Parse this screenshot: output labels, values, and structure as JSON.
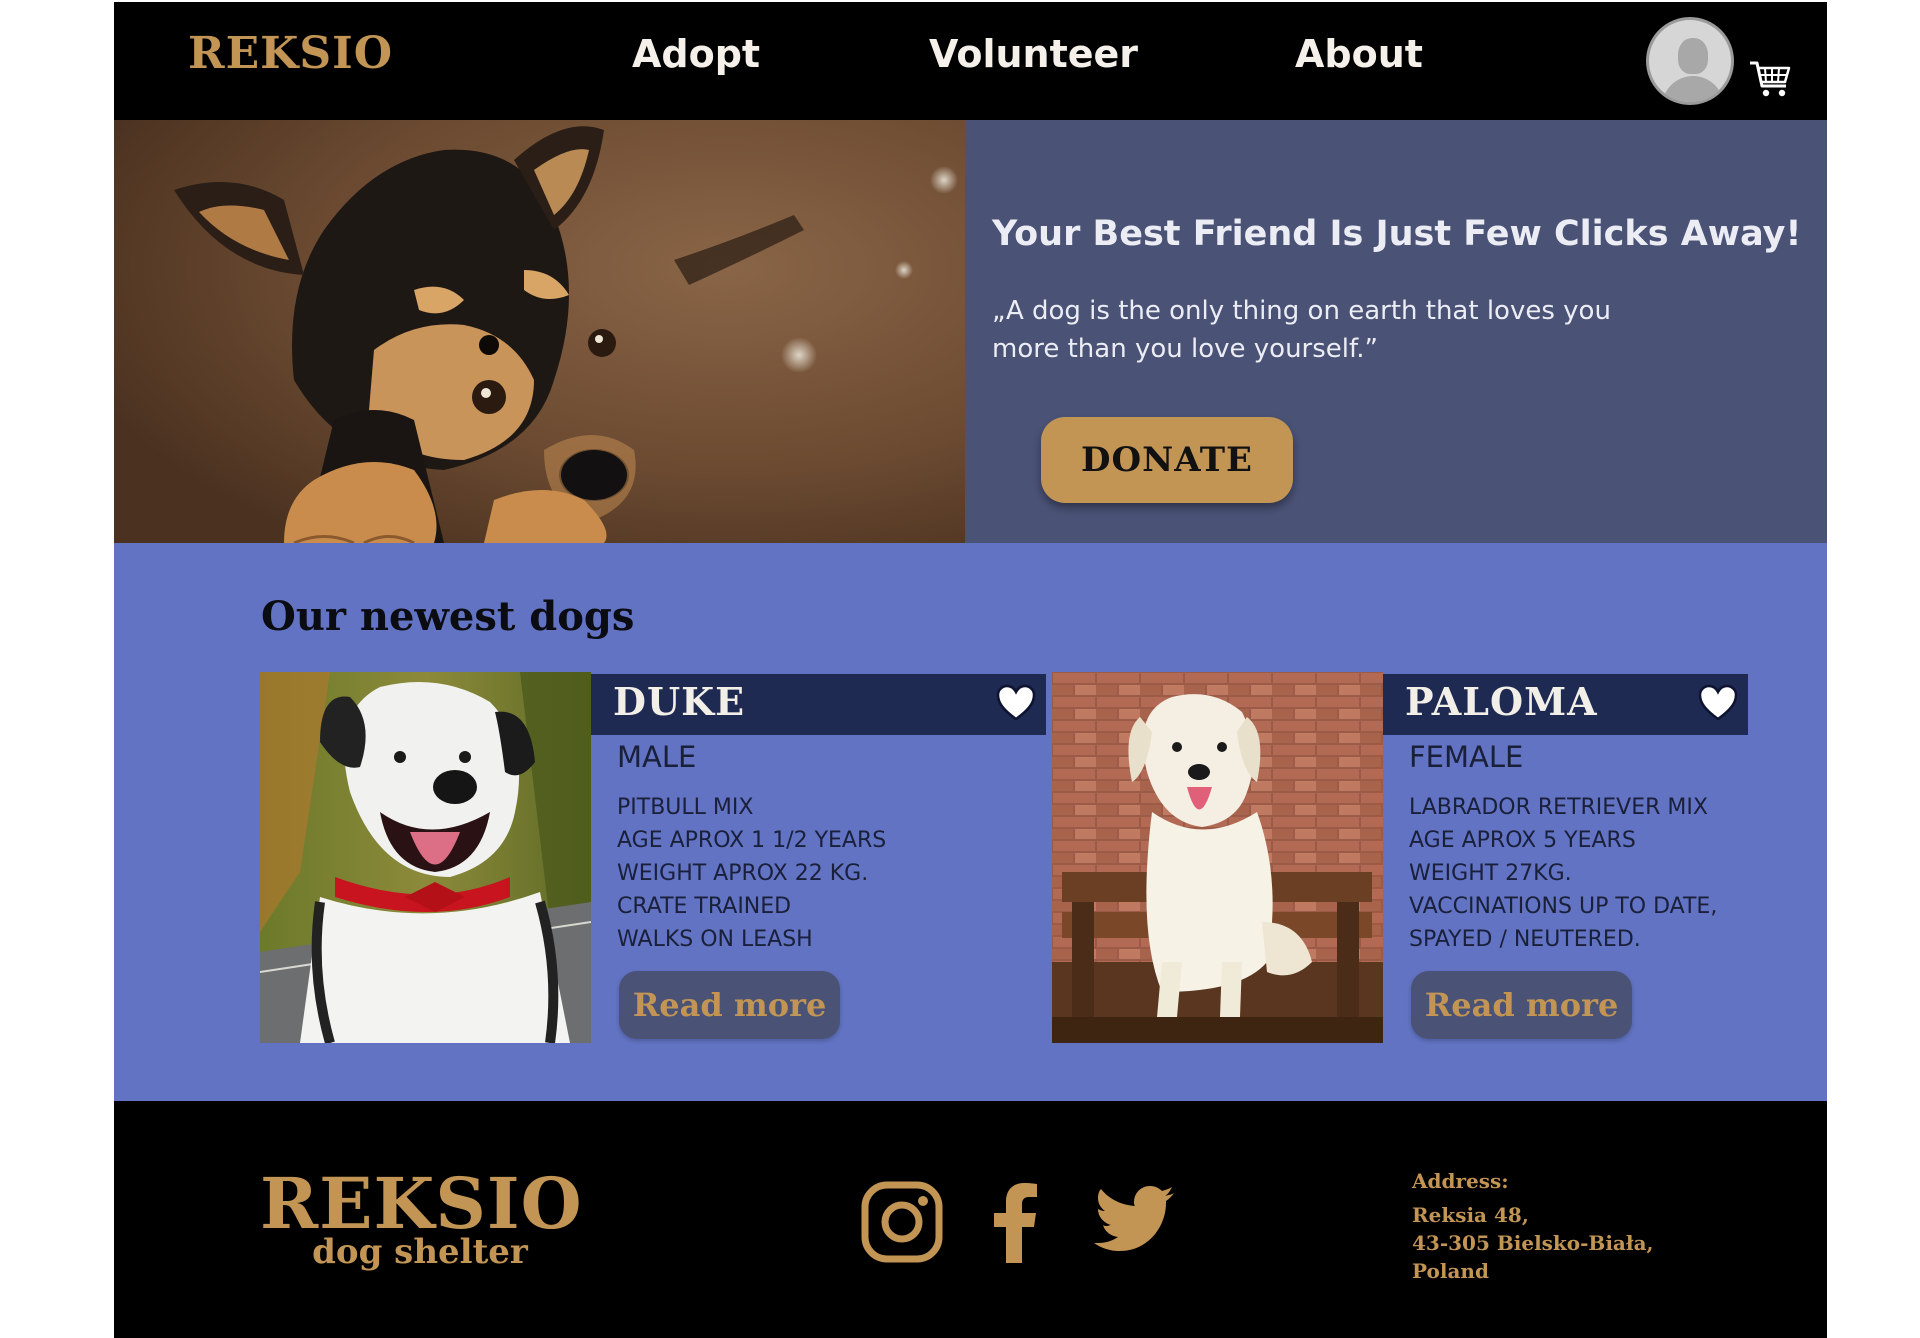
{
  "header": {
    "logo": "REKSIO",
    "nav": [
      "Adopt",
      "Volunteer",
      "About"
    ],
    "avatar_icon": "user-avatar-icon",
    "cart_icon": "shopping-cart-icon"
  },
  "hero": {
    "title": "Your Best Friend Is Just Few Clicks Away!",
    "quote": "„A dog is the only thing on earth that loves you more than you love yourself.”",
    "donate_label": "DONATE"
  },
  "dogs_section": {
    "title": "Our newest dogs",
    "dogs": [
      {
        "name": "DUKE",
        "sex": "MALE",
        "facts": [
          "PITBULL MIX",
          "AGE APROX 1 1/2 YEARS",
          "WEIGHT APROX 22 KG.",
          "CRATE TRAINED",
          "WALKS ON LEASH"
        ],
        "read_more": "Read more"
      },
      {
        "name": "PALOMA",
        "sex": "FEMALE",
        "facts": [
          "LABRADOR RETRIEVER MIX",
          "AGE APROX 5 YEARS",
          "WEIGHT 27KG.",
          "VACCINATIONS UP TO DATE,",
          "SPAYED / NEUTERED."
        ],
        "read_more": "Read more"
      }
    ]
  },
  "footer": {
    "logo_main": "REKSIO",
    "logo_sub": "dog shelter",
    "social_icons": [
      "instagram-icon",
      "facebook-icon",
      "twitter-icon"
    ],
    "address_label": "Address:",
    "address_lines": [
      "Reksia 48,",
      "43-305 Bielsko-Biała,",
      "Poland"
    ]
  },
  "colors": {
    "accent_gold": "#c29554",
    "header_black": "#000000",
    "hero_panel": "#4a5276",
    "section_blue": "#6173c2",
    "name_bar_navy": "#1f2a52"
  }
}
